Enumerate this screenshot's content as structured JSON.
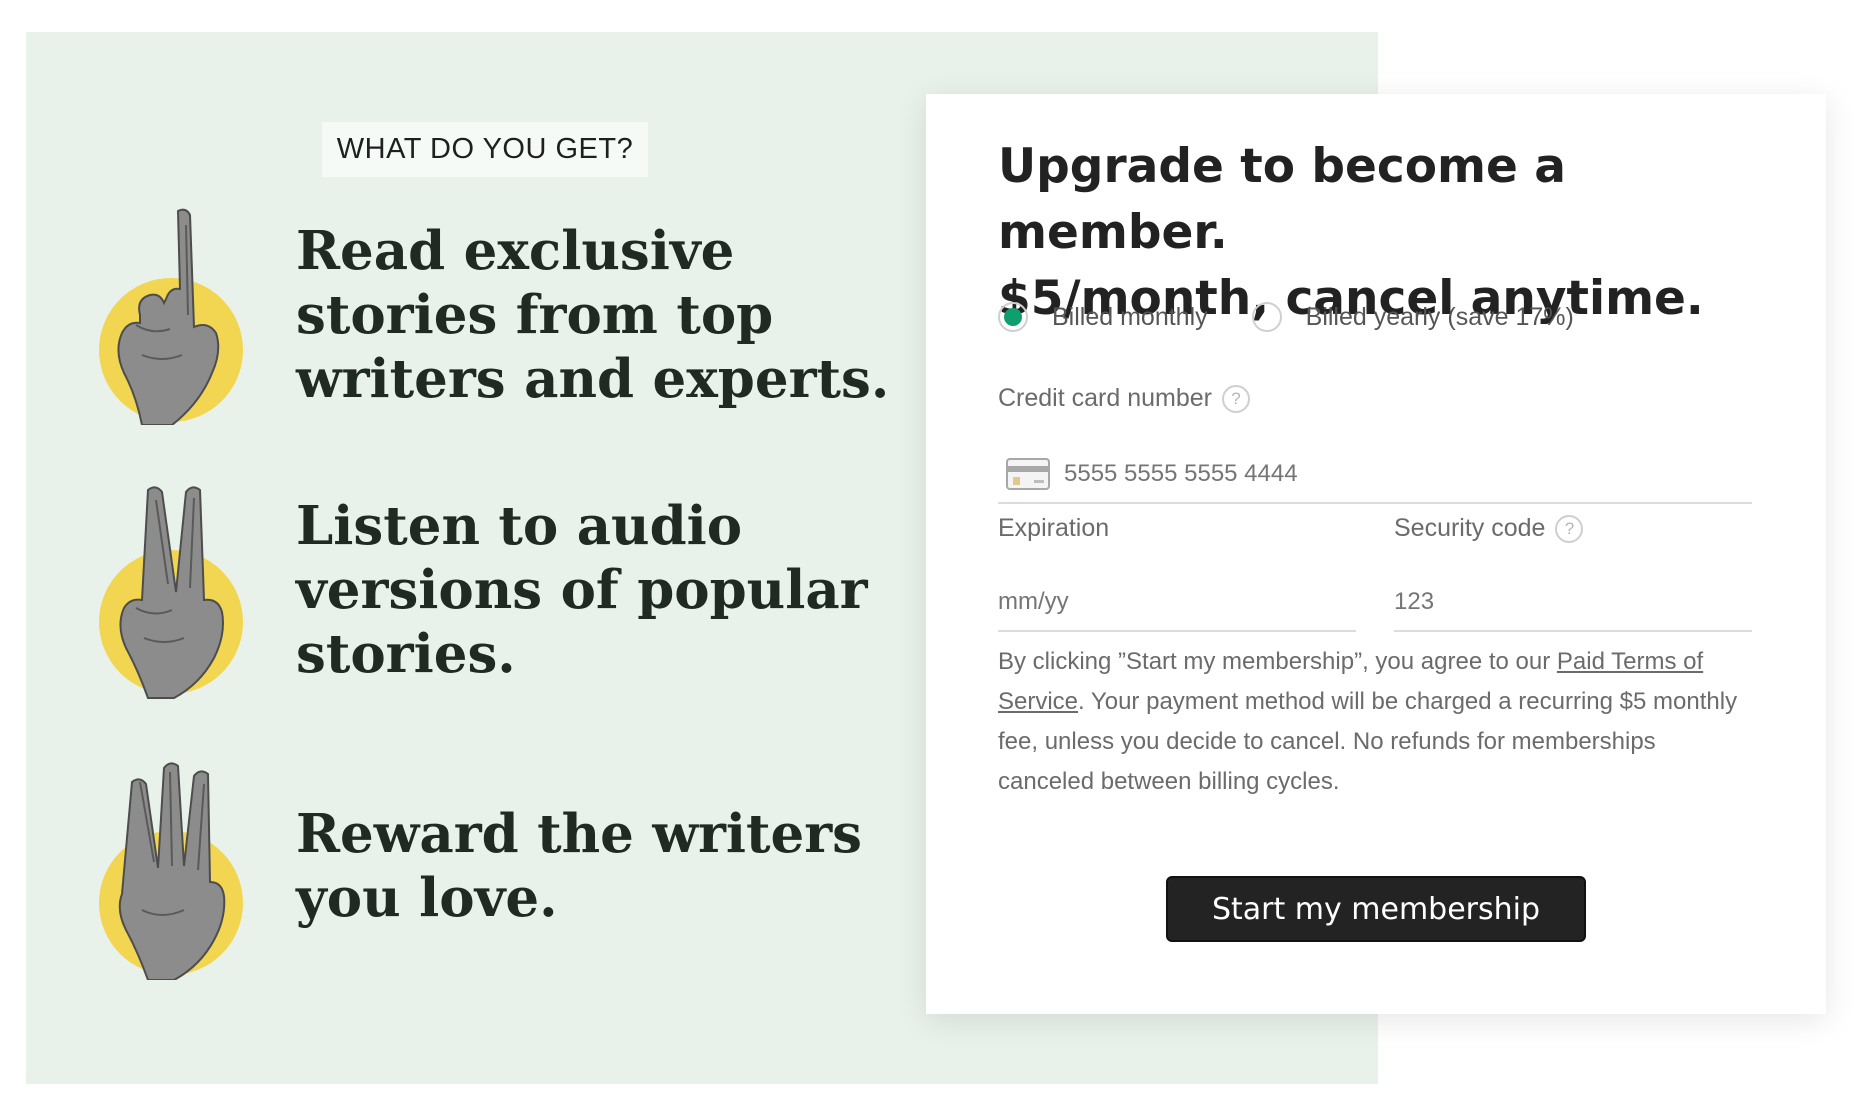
{
  "benefits": {
    "tag": "WHAT DO YOU GET?",
    "items": [
      {
        "icon": "one-finger-hand-icon",
        "text": "Read exclusive stories from top writers and experts."
      },
      {
        "icon": "peace-sign-hand-icon",
        "text": "Listen to audio versions of popular stories."
      },
      {
        "icon": "three-fingers-hand-icon",
        "text": "Reward the writers you love."
      }
    ],
    "colors": {
      "panel": "#e8f2ea",
      "accent_circle": "#f2d550"
    }
  },
  "form": {
    "title_line1": "Upgrade to become a member.",
    "title_line2": "$5/month, cancel anytime.",
    "billing": {
      "monthly_label": "Billed monthly",
      "yearly_label": "Billed yearly (save 17%)",
      "selected": "monthly"
    },
    "card_number": {
      "label": "Credit card number",
      "placeholder": "5555 5555 5555 4444",
      "icon": "credit-card-icon"
    },
    "expiration": {
      "label": "Expiration",
      "placeholder": "mm/yy"
    },
    "security_code": {
      "label": "Security code",
      "placeholder": "123"
    },
    "help_glyph": "?",
    "legal": {
      "before_link": "By clicking ”Start my membership”, you agree to our ",
      "link": "Paid Terms of Service",
      "after_link": ". Your payment method will be charged a recurring $5 monthly fee, unless you decide to cancel. No refunds for memberships canceled between billing cycles."
    },
    "submit_label": "Start my membership",
    "colors": {
      "radio_selected": "#0f9f6e",
      "button": "#232323"
    }
  }
}
